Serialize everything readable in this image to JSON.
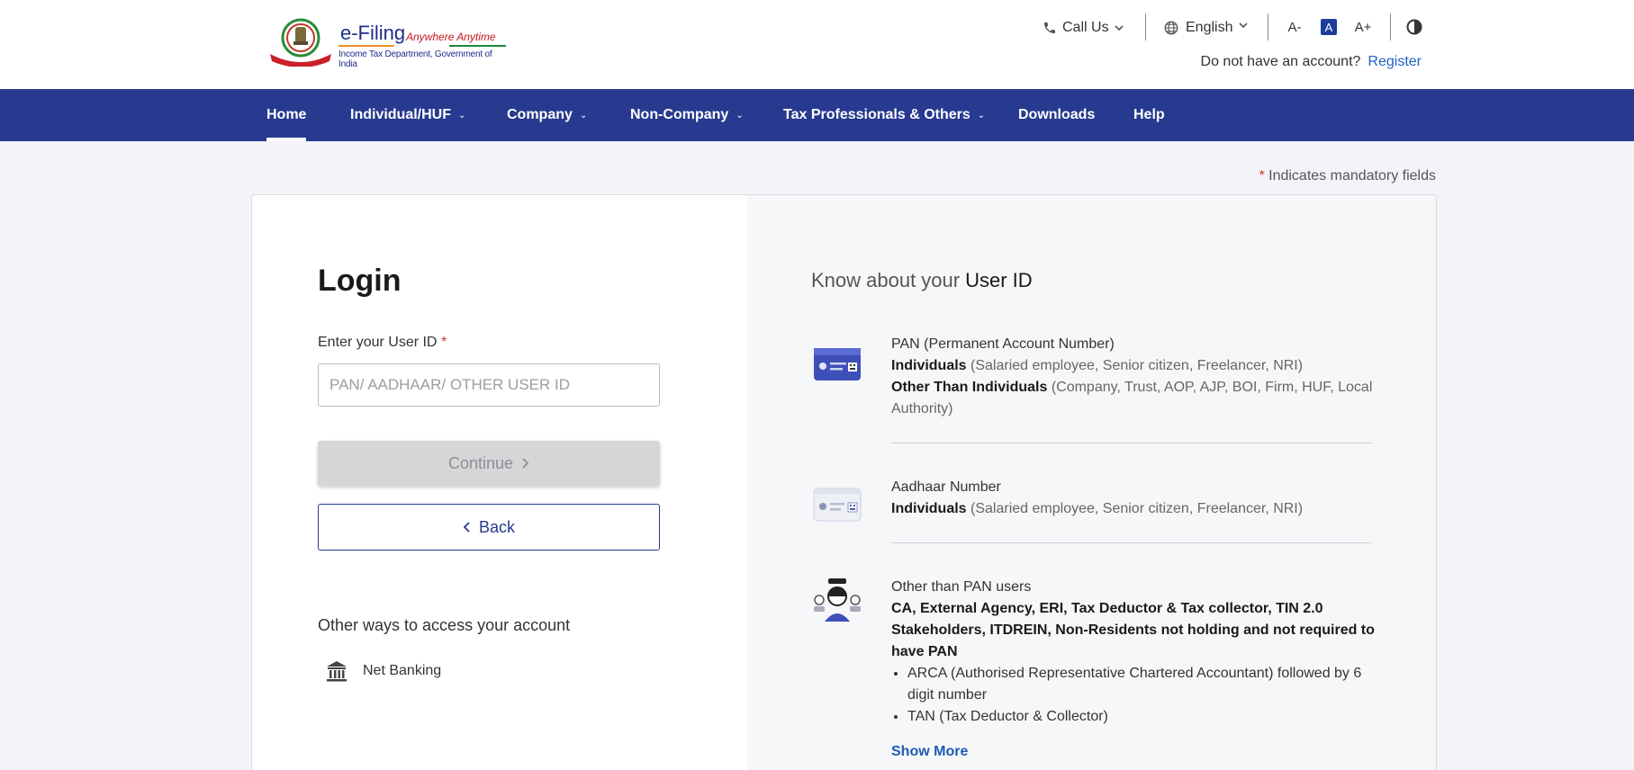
{
  "header": {
    "logo_main": "e-Filing",
    "logo_tag": "Anywhere Anytime",
    "logo_sub": "Income Tax Department, Government of India",
    "call_us": "Call Us",
    "language": "English",
    "font_decrease": "A-",
    "font_default": "A",
    "font_increase": "A+",
    "no_account_text": "Do not have an account?",
    "register_label": "Register"
  },
  "nav": {
    "items": [
      {
        "label": "Home"
      },
      {
        "label": "Individual/HUF"
      },
      {
        "label": "Company"
      },
      {
        "label": "Non-Company"
      },
      {
        "label": "Tax Professionals & Others"
      },
      {
        "label": "Downloads"
      },
      {
        "label": "Help"
      }
    ],
    "active": "Home"
  },
  "mandatory_note": {
    "star": "*",
    "text": "Indicates mandatory fields"
  },
  "login": {
    "title": "Login",
    "user_id_label": "Enter your User ID",
    "required_star": "*",
    "user_id_placeholder": "PAN/ AADHAAR/ OTHER USER ID",
    "user_id_value": "",
    "continue_label": "Continue",
    "back_label": "Back",
    "other_ways_heading": "Other ways to access your account",
    "net_banking_label": "Net Banking"
  },
  "know": {
    "title_prefix": "Know about your",
    "title_emphasis": "User ID",
    "pan": {
      "title": "PAN (Permanent Account Number)",
      "line1_bold": "Individuals",
      "line1_rest": "(Salaried employee, Senior citizen, Freelancer, NRI)",
      "line2_bold": "Other Than Individuals",
      "line2_rest": "(Company, Trust, AOP, AJP, BOI, Firm, HUF, Local Authority)"
    },
    "aadhaar": {
      "title": "Aadhaar Number",
      "line1_bold": "Individuals",
      "line1_rest": "(Salaried employee, Senior citizen, Freelancer, NRI)"
    },
    "other": {
      "title": "Other than PAN users",
      "bold_text": "CA, External Agency, ERI, Tax Deductor & Tax collector, TIN 2.0 Stakeholders, ITDREIN, Non-Residents not holding and not required to have PAN",
      "bullet1": "ARCA (Authorised Representative Chartered Accountant) followed by 6 digit number",
      "bullet2": "TAN (Tax Deductor & Collector)"
    },
    "show_more": "Show More"
  },
  "colors": {
    "nav_bg": "#273a8f",
    "link": "#1e63c4",
    "required": "#d0342c",
    "disabled_btn": "#d5d6d8"
  }
}
